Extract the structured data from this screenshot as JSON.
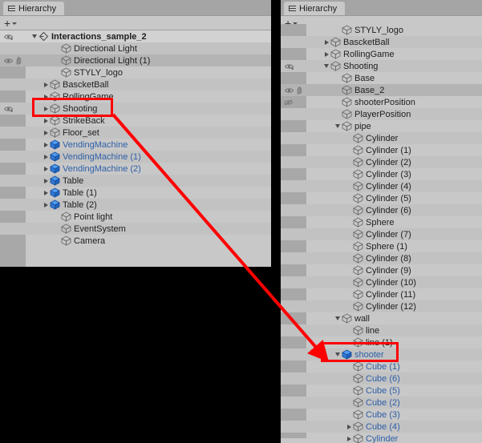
{
  "app": {
    "name": "Unity Editor Hierarchy",
    "accent_red": "#ff0000",
    "link_blue": "#2d5fa8",
    "panel_bg": "#c8c8c8"
  },
  "left_panel": {
    "tab": {
      "label": "Hierarchy",
      "icon": "hierarchy-lines-icon"
    },
    "toolbar": {
      "add_label": "+",
      "dropdown_icon": "caret-down-icon"
    },
    "rows": [
      {
        "label": "Interactions_sample_2",
        "depth": 0,
        "toggle": "open",
        "icon": "scene-icon",
        "style": "scene-header",
        "vis": "eye-dot",
        "blue": false
      },
      {
        "label": "Directional Light",
        "depth": 2,
        "toggle": "none",
        "icon": "cube-icon",
        "style": "alt",
        "vis": "",
        "blue": false
      },
      {
        "label": "Directional Light (1)",
        "depth": 2,
        "toggle": "none",
        "icon": "cube-icon",
        "style": "sel",
        "vis": "eye-hand",
        "blue": false
      },
      {
        "label": "STYLY_logo",
        "depth": 2,
        "toggle": "none",
        "icon": "cube-icon",
        "style": "",
        "vis": "",
        "blue": false
      },
      {
        "label": "BascketBall",
        "depth": 1,
        "toggle": "closed",
        "icon": "cube-icon",
        "style": "alt",
        "vis": "",
        "blue": false
      },
      {
        "label": "RollingGame",
        "depth": 1,
        "toggle": "closed",
        "icon": "cube-icon",
        "style": "",
        "vis": "",
        "blue": false
      },
      {
        "label": "Shooting",
        "depth": 1,
        "toggle": "closed",
        "icon": "cube-icon",
        "style": "alt",
        "vis": "eye-dot",
        "blue": false
      },
      {
        "label": "StrikeBack",
        "depth": 1,
        "toggle": "closed",
        "icon": "cube-icon",
        "style": "",
        "vis": "",
        "blue": false
      },
      {
        "label": "Floor_set",
        "depth": 1,
        "toggle": "closed",
        "icon": "cube-icon",
        "style": "alt",
        "vis": "",
        "blue": false
      },
      {
        "label": "VendingMachine",
        "depth": 1,
        "toggle": "closed",
        "icon": "prefab-icon",
        "style": "",
        "vis": "",
        "blue": true
      },
      {
        "label": "VendingMachine (1)",
        "depth": 1,
        "toggle": "closed",
        "icon": "prefab-icon",
        "style": "alt",
        "vis": "",
        "blue": true
      },
      {
        "label": "VendingMachine (2)",
        "depth": 1,
        "toggle": "closed",
        "icon": "prefab-icon",
        "style": "",
        "vis": "",
        "blue": true
      },
      {
        "label": "Table",
        "depth": 1,
        "toggle": "closed",
        "icon": "prefab-icon",
        "style": "alt",
        "vis": "",
        "blue": false
      },
      {
        "label": "Table (1)",
        "depth": 1,
        "toggle": "closed",
        "icon": "prefab-icon",
        "style": "",
        "vis": "",
        "blue": false
      },
      {
        "label": "Table (2)",
        "depth": 1,
        "toggle": "closed",
        "icon": "prefab-icon",
        "style": "alt",
        "vis": "",
        "blue": false
      },
      {
        "label": "Point light",
        "depth": 2,
        "toggle": "none",
        "icon": "cube-icon",
        "style": "",
        "vis": "",
        "blue": false
      },
      {
        "label": "EventSystem",
        "depth": 2,
        "toggle": "none",
        "icon": "cube-icon",
        "style": "alt",
        "vis": "",
        "blue": false
      },
      {
        "label": "Camera",
        "depth": 2,
        "toggle": "none",
        "icon": "cube-icon",
        "style": "",
        "vis": "",
        "blue": false
      }
    ]
  },
  "right_panel": {
    "tab": {
      "label": "Hierarchy",
      "icon": "hierarchy-lines-icon"
    },
    "toolbar": {
      "add_label": "+",
      "dropdown_icon": "caret-down-icon"
    },
    "rows": [
      {
        "label": "STYLY_logo",
        "depth": 2,
        "toggle": "none",
        "icon": "cube-icon",
        "style": "clip-top",
        "vis": "",
        "blue": false
      },
      {
        "label": "BascketBall",
        "depth": 1,
        "toggle": "closed",
        "icon": "cube-icon",
        "style": "alt",
        "vis": "",
        "blue": false
      },
      {
        "label": "RollingGame",
        "depth": 1,
        "toggle": "closed",
        "icon": "cube-icon",
        "style": "",
        "vis": "",
        "blue": false
      },
      {
        "label": "Shooting",
        "depth": 1,
        "toggle": "open",
        "icon": "cube-icon",
        "style": "alt",
        "vis": "eye-dot",
        "blue": false
      },
      {
        "label": "Base",
        "depth": 2,
        "toggle": "none",
        "icon": "cube-icon",
        "style": "",
        "vis": "",
        "blue": false
      },
      {
        "label": "Base_2",
        "depth": 2,
        "toggle": "none",
        "icon": "cube-icon",
        "style": "sel",
        "vis": "eye-hand",
        "blue": false
      },
      {
        "label": "shooterPosition",
        "depth": 2,
        "toggle": "none",
        "icon": "cube-icon",
        "style": "",
        "vis": "eye-slash",
        "blue": false
      },
      {
        "label": "PlayerPosition",
        "depth": 2,
        "toggle": "none",
        "icon": "cube-icon",
        "style": "alt",
        "vis": "",
        "blue": false
      },
      {
        "label": "pipe",
        "depth": 2,
        "toggle": "open",
        "icon": "cube-icon",
        "style": "",
        "vis": "",
        "blue": false
      },
      {
        "label": "Cylinder",
        "depth": 3,
        "toggle": "none",
        "icon": "cube-icon",
        "style": "alt",
        "vis": "",
        "blue": false
      },
      {
        "label": "Cylinder (1)",
        "depth": 3,
        "toggle": "none",
        "icon": "cube-icon",
        "style": "",
        "vis": "",
        "blue": false
      },
      {
        "label": "Cylinder (2)",
        "depth": 3,
        "toggle": "none",
        "icon": "cube-icon",
        "style": "alt",
        "vis": "",
        "blue": false
      },
      {
        "label": "Cylinder (3)",
        "depth": 3,
        "toggle": "none",
        "icon": "cube-icon",
        "style": "",
        "vis": "",
        "blue": false
      },
      {
        "label": "Cylinder (4)",
        "depth": 3,
        "toggle": "none",
        "icon": "cube-icon",
        "style": "alt",
        "vis": "",
        "blue": false
      },
      {
        "label": "Cylinder (5)",
        "depth": 3,
        "toggle": "none",
        "icon": "cube-icon",
        "style": "",
        "vis": "",
        "blue": false
      },
      {
        "label": "Cylinder (6)",
        "depth": 3,
        "toggle": "none",
        "icon": "cube-icon",
        "style": "alt",
        "vis": "",
        "blue": false
      },
      {
        "label": "Sphere",
        "depth": 3,
        "toggle": "none",
        "icon": "cube-icon",
        "style": "",
        "vis": "",
        "blue": false
      },
      {
        "label": "Cylinder (7)",
        "depth": 3,
        "toggle": "none",
        "icon": "cube-icon",
        "style": "alt",
        "vis": "",
        "blue": false
      },
      {
        "label": "Sphere (1)",
        "depth": 3,
        "toggle": "none",
        "icon": "cube-icon",
        "style": "",
        "vis": "",
        "blue": false
      },
      {
        "label": "Cylinder (8)",
        "depth": 3,
        "toggle": "none",
        "icon": "cube-icon",
        "style": "alt",
        "vis": "",
        "blue": false
      },
      {
        "label": "Cylinder (9)",
        "depth": 3,
        "toggle": "none",
        "icon": "cube-icon",
        "style": "",
        "vis": "",
        "blue": false
      },
      {
        "label": "Cylinder (10)",
        "depth": 3,
        "toggle": "none",
        "icon": "cube-icon",
        "style": "alt",
        "vis": "",
        "blue": false
      },
      {
        "label": "Cylinder (11)",
        "depth": 3,
        "toggle": "none",
        "icon": "cube-icon",
        "style": "",
        "vis": "",
        "blue": false
      },
      {
        "label": "Cylinder (12)",
        "depth": 3,
        "toggle": "none",
        "icon": "cube-icon",
        "style": "alt",
        "vis": "",
        "blue": false
      },
      {
        "label": "wall",
        "depth": 2,
        "toggle": "open",
        "icon": "cube-icon",
        "style": "",
        "vis": "",
        "blue": false
      },
      {
        "label": "line",
        "depth": 3,
        "toggle": "none",
        "icon": "cube-icon",
        "style": "alt",
        "vis": "",
        "blue": false
      },
      {
        "label": "line (1)",
        "depth": 3,
        "toggle": "none",
        "icon": "cube-icon",
        "style": "",
        "vis": "",
        "blue": false
      },
      {
        "label": "shooter",
        "depth": 2,
        "toggle": "open",
        "icon": "prefab-icon",
        "style": "alt",
        "vis": "",
        "blue": true
      },
      {
        "label": "Cube (1)",
        "depth": 3,
        "toggle": "none",
        "icon": "cube-icon",
        "style": "",
        "vis": "",
        "blue": true
      },
      {
        "label": "Cube (6)",
        "depth": 3,
        "toggle": "none",
        "icon": "cube-icon",
        "style": "alt",
        "vis": "",
        "blue": true
      },
      {
        "label": "Cube (5)",
        "depth": 3,
        "toggle": "none",
        "icon": "cube-icon",
        "style": "",
        "vis": "",
        "blue": true
      },
      {
        "label": "Cube (2)",
        "depth": 3,
        "toggle": "none",
        "icon": "cube-icon",
        "style": "alt",
        "vis": "",
        "blue": true
      },
      {
        "label": "Cube (3)",
        "depth": 3,
        "toggle": "none",
        "icon": "cube-icon",
        "style": "",
        "vis": "",
        "blue": true
      },
      {
        "label": "Cube (4)",
        "depth": 3,
        "toggle": "closed",
        "icon": "cube-icon",
        "style": "alt",
        "vis": "",
        "blue": true
      },
      {
        "label": "Cylinder",
        "depth": 3,
        "toggle": "closed",
        "icon": "cube-icon",
        "style": "",
        "vis": "",
        "blue": true
      }
    ]
  },
  "annotations": {
    "box_left": {
      "target": "Shooting",
      "color": "#ff0000"
    },
    "box_right": {
      "target": "shooter",
      "color": "#ff0000"
    },
    "arrow": {
      "from": "Shooting",
      "to": "shooter",
      "color": "#ff0000"
    }
  }
}
